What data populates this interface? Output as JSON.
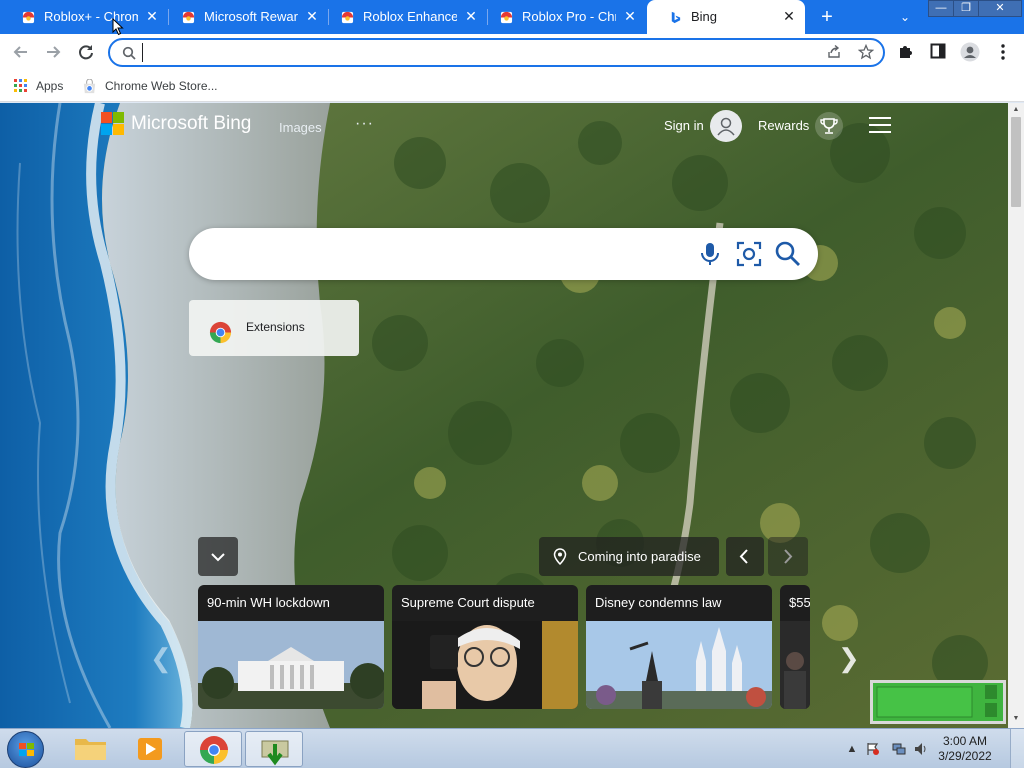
{
  "browser": {
    "tabs": [
      {
        "title": "Roblox+ - Chrome",
        "active": false
      },
      {
        "title": "Microsoft Rewards",
        "active": false
      },
      {
        "title": "Roblox Enhancer",
        "active": false
      },
      {
        "title": "Roblox Pro - Chrome",
        "active": false
      },
      {
        "title": "Bing",
        "active": true
      }
    ],
    "close_glyph": "✕",
    "new_tab_glyph": "+",
    "tab_search_glyph": "⌄",
    "window_controls": {
      "minimize": "—",
      "restore": "❐",
      "close": "✕"
    },
    "omnibox": {
      "value": "",
      "placeholder": ""
    },
    "bookmarks": [
      {
        "label": "Apps",
        "icon": "apps-grid-icon"
      },
      {
        "label": "Chrome Web Store...",
        "icon": "chrome-web-store-icon"
      }
    ],
    "colors": {
      "tabstrip": "#1a73e8",
      "omnibox_border": "#1a73e8"
    }
  },
  "bing": {
    "brand": "Microsoft Bing",
    "nav": {
      "images": "Images",
      "more": "···"
    },
    "signin": "Sign in",
    "rewards": "Rewards",
    "search": {
      "value": "",
      "placeholder": ""
    },
    "suggestion": {
      "label": "Extensions",
      "icon": "chrome-logo-icon"
    },
    "location_caption": "Coming into paradise",
    "news": [
      {
        "headline": "90-min WH lockdown",
        "image": "white-house"
      },
      {
        "headline": "Supreme Court dispute",
        "image": "man-with-camera"
      },
      {
        "headline": "Disney condemns law",
        "image": "disney-castle"
      },
      {
        "headline": "$55",
        "image": "crowd"
      }
    ]
  },
  "taskbar": {
    "apps": [
      {
        "name": "file-explorer",
        "active": false
      },
      {
        "name": "media-player",
        "active": false
      },
      {
        "name": "chrome",
        "active": true
      },
      {
        "name": "download-app",
        "active": true
      }
    ],
    "tray_show_hidden": "▲",
    "clock": {
      "time": "3:00 AM",
      "date": "3/29/2022"
    }
  }
}
